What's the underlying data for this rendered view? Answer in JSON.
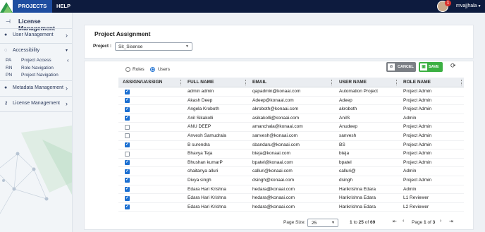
{
  "topbar": {
    "nav": [
      "PROJECTS",
      "HELP"
    ],
    "notifications": "1",
    "username": "mvajjhala"
  },
  "sidebar": {
    "title": "License Management",
    "menu": [
      {
        "label": "User Management"
      },
      {
        "label": "Accessibility"
      },
      {
        "label": "Metadata Management"
      },
      {
        "label": "License Management"
      }
    ],
    "sub_items": [
      {
        "code": "PA",
        "label": "Project Access"
      },
      {
        "code": "RN",
        "label": "Role Navigation"
      },
      {
        "code": "PN",
        "label": "Project Navigation"
      }
    ]
  },
  "assignment": {
    "title": "Project Assignment",
    "project_label": "Project :",
    "project_value": "Sit_Sisense"
  },
  "view": {
    "options": [
      "Roles",
      "Users"
    ],
    "selected": "Users"
  },
  "toolbar": {
    "cancel": "CANCEL",
    "save": "SAVE"
  },
  "table": {
    "columns": [
      "ASSIGN/UASSIGN",
      "FULL NAME",
      "EMAIL",
      "USER NAME",
      "ROLE NAME"
    ],
    "rows": [
      {
        "checked": true,
        "name": "admin admin",
        "email": "qapadmin@konaai.com",
        "user": "Automation Project",
        "role": "Project Admin"
      },
      {
        "checked": true,
        "name": "Akash Deep",
        "email": "Adeep@konaai.com",
        "user": "Adeep",
        "role": "Project Admin"
      },
      {
        "checked": true,
        "name": "Angela Kroboth",
        "email": "akroboth@konaai.com",
        "user": "akroboth",
        "role": "Project Admin"
      },
      {
        "checked": true,
        "name": "Anil Sikakolli",
        "email": "asikakolli@konaai.com",
        "user": "AnilS",
        "role": "Admin"
      },
      {
        "checked": false,
        "name": "ANU DEEP",
        "email": "amanchala@konaai.com",
        "user": "Anudeep",
        "role": "Project Admin"
      },
      {
        "checked": false,
        "name": "Anvesh Samudrala",
        "email": "sanvesh@konaai.com",
        "user": "sanvesh",
        "role": "Project Admin"
      },
      {
        "checked": true,
        "name": "B surendra",
        "email": "sbandaru@konaai.com",
        "user": "BS",
        "role": "Project Admin"
      },
      {
        "checked": false,
        "name": "Bhavya Teja",
        "email": "bteja@konaai.com",
        "user": "bteja",
        "role": "Project Admin"
      },
      {
        "checked": true,
        "name": "Bhushan kumarP",
        "email": "bpatel@konaai.com",
        "user": "bpatel",
        "role": "Project Admin"
      },
      {
        "checked": true,
        "name": "chaitanya alluri",
        "email": "calluri@konaai.com",
        "user": "calluri@",
        "role": "Admin"
      },
      {
        "checked": true,
        "name": "Divya singh",
        "email": "dsingh@konaai.com",
        "user": "dsingh",
        "role": "Project Admin"
      },
      {
        "checked": true,
        "name": "Edara Hari Krishna",
        "email": "hedara@konaai.com",
        "user": "Harikrishna Edara",
        "role": "Admin"
      },
      {
        "checked": true,
        "name": "Edara Hari Krishna",
        "email": "hedara@konaai.com",
        "user": "Harikrishna Edara",
        "role": "L1 Reviewer"
      },
      {
        "checked": true,
        "name": "Edara Hari Krishna",
        "email": "hedara@konaai.com",
        "user": "Harikrishna Edara",
        "role": "L2 Reviewer"
      }
    ]
  },
  "pagination": {
    "page_size_label": "Page Size:",
    "page_size": "25",
    "range_from": "1",
    "range_to_word": "to",
    "range_to": "25",
    "of_word": "of",
    "total": "69",
    "page_word": "Page",
    "page": "1",
    "pages": "3"
  },
  "colors": {
    "topbar": "#0d1b3e",
    "active_nav": "#1e4da0",
    "save": "#3cb043",
    "cancel": "#7b7f85",
    "checkbox": "#1b6fd1"
  }
}
